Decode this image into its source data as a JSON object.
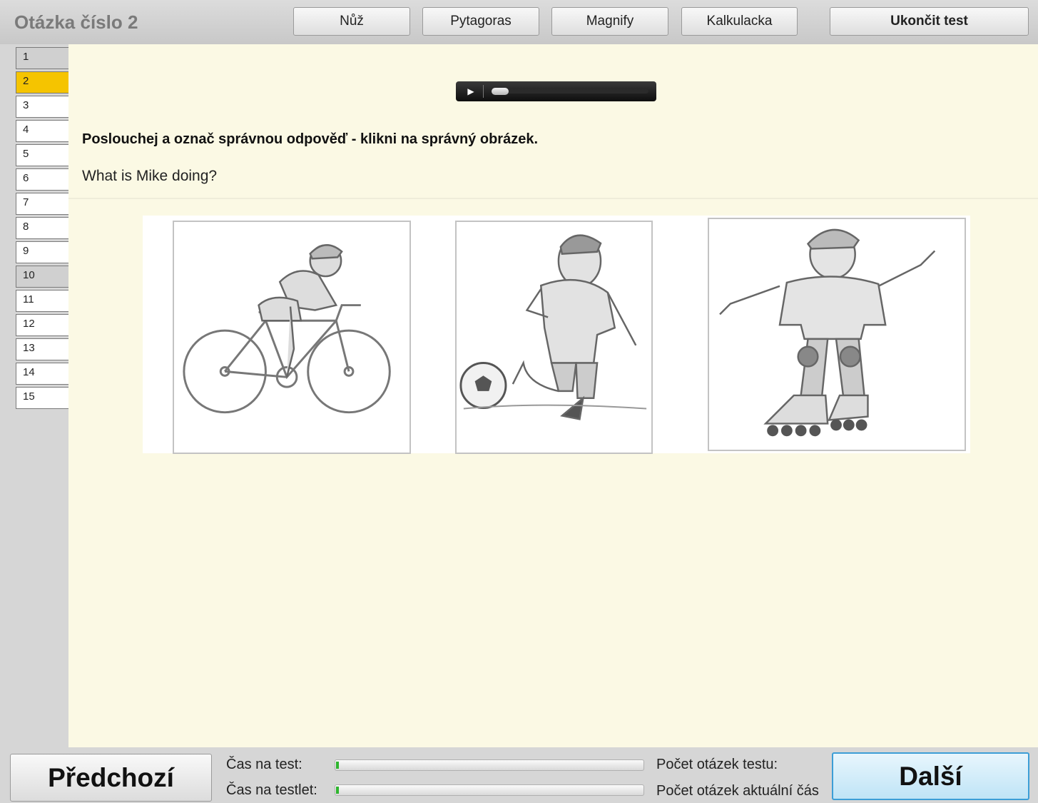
{
  "header": {
    "title": "Otázka číslo 2",
    "tools": [
      "Nůž",
      "Pytagoras",
      "Magnify",
      "Kalkulacka"
    ],
    "end_test": "Ukončit test"
  },
  "sidebar": {
    "items": [
      "1",
      "2",
      "3",
      "4",
      "5",
      "6",
      "7",
      "8",
      "9",
      "10",
      "11",
      "12",
      "13",
      "14",
      "15"
    ],
    "current": "2",
    "visited": [
      "1",
      "10"
    ]
  },
  "player": {
    "play_icon": "play-icon",
    "progress": 0.0
  },
  "main": {
    "instruction": "Poslouchej a označ správnou odpověď - klikni na správný obrázek.",
    "question": "What is Mike doing?",
    "answers": [
      "cycling-picture",
      "football-picture",
      "rollerblading-picture"
    ]
  },
  "footer": {
    "prev": "Předchozí",
    "next": "Další",
    "time_test_label": "Čas na test:",
    "time_testlet_label": "Čas na testlet:",
    "time_test_progress": 0.01,
    "time_testlet_progress": 0.01,
    "count_test_label": "Počet otázek testu:",
    "count_part_label": "Počet otázek aktuální čás"
  }
}
